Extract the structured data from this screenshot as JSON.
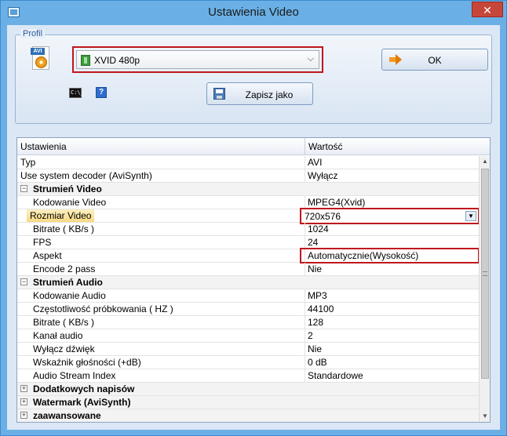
{
  "window": {
    "title": "Ustawienia Video",
    "close_label": "✕"
  },
  "profile": {
    "group_label": "Profil",
    "avi_tag": "AVI",
    "selected": "XVID 480p",
    "ok_label": "OK",
    "save_as_label": "Zapisz jako",
    "cmd_label": "C:\\_",
    "help_label": "?"
  },
  "grid": {
    "col_settings": "Ustawienia",
    "col_value": "Wartość",
    "rows": [
      {
        "name": "Typ",
        "value": "AVI"
      },
      {
        "name": "Use system decoder (AviSynth)",
        "value": "Wyłącz"
      },
      {
        "name": "Strumień Video",
        "value": ""
      },
      {
        "name": "Kodowanie Video",
        "value": "MPEG4(Xvid)"
      },
      {
        "name": "Rozmiar Video",
        "value": "720x576"
      },
      {
        "name": "Bitrate ( KB/s )",
        "value": "1024"
      },
      {
        "name": "FPS",
        "value": "24"
      },
      {
        "name": "Aspekt",
        "value": "Automatycznie(Wysokość)"
      },
      {
        "name": "Encode 2 pass",
        "value": "Nie"
      },
      {
        "name": "Strumień Audio",
        "value": ""
      },
      {
        "name": "Kodowanie Audio",
        "value": "MP3"
      },
      {
        "name": "Częstotliwość próbkowania ( HZ )",
        "value": "44100"
      },
      {
        "name": "Bitrate ( KB/s )",
        "value": "128"
      },
      {
        "name": "Kanał audio",
        "value": "2"
      },
      {
        "name": "Wyłącz dźwięk",
        "value": "Nie"
      },
      {
        "name": "Wskaźnik głośności (+dB)",
        "value": "0 dB"
      },
      {
        "name": "Audio Stream Index",
        "value": "Standardowe"
      },
      {
        "name": "Dodatkowych napisów",
        "value": ""
      },
      {
        "name": "Watermark (AviSynth)",
        "value": ""
      },
      {
        "name": "zaawansowane",
        "value": ""
      }
    ],
    "expander_minus": "−",
    "expander_plus": "+",
    "scroll_up": "▲",
    "scroll_down": "▼",
    "dropdown_glyph": "▼"
  }
}
